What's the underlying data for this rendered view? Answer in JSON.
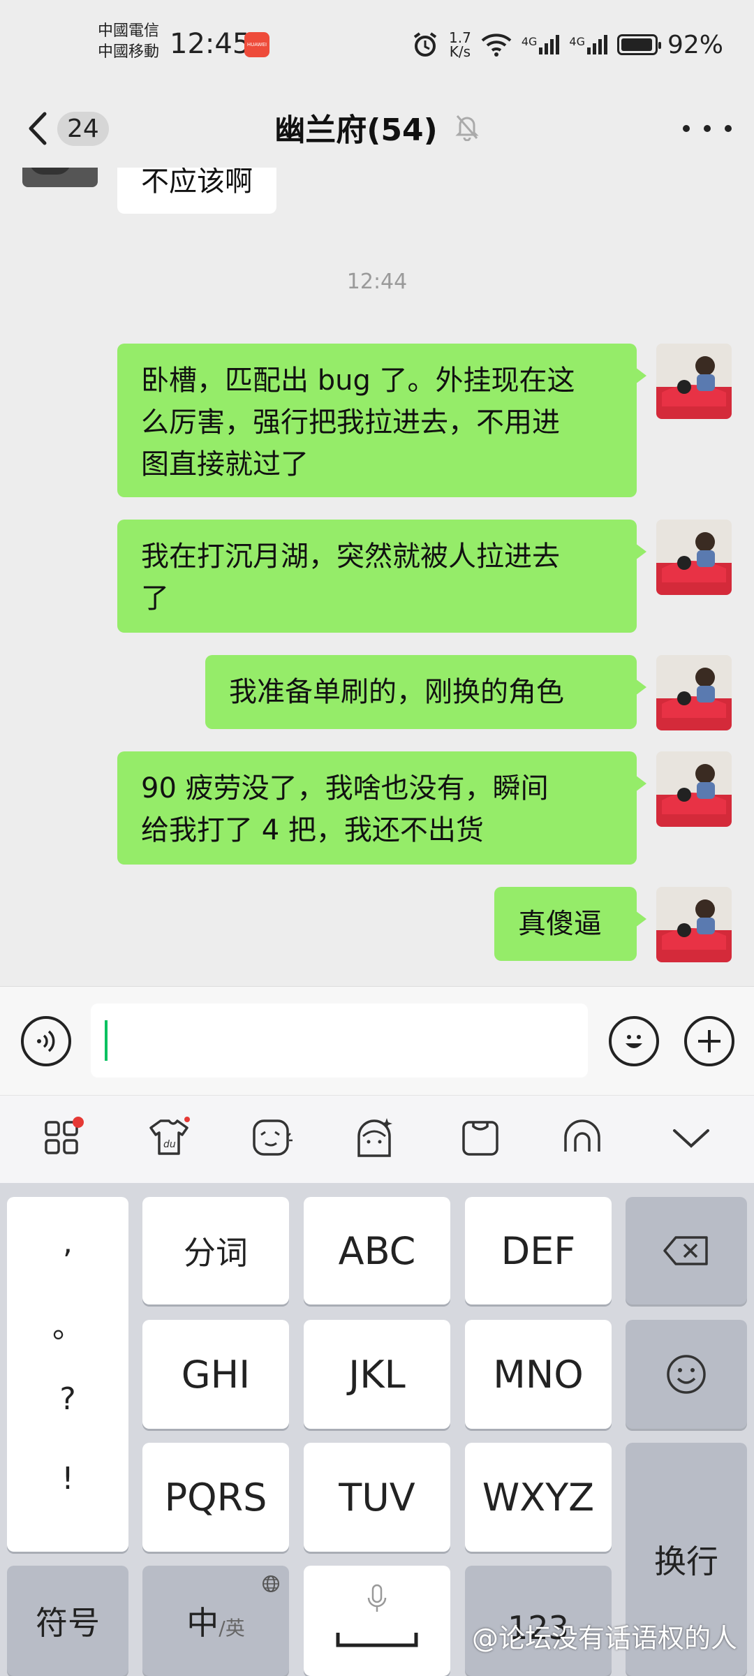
{
  "status_bar": {
    "carrier_1": "中國電信",
    "carrier_2": "中國移動",
    "time": "12:45",
    "net_speed_value": "1.7",
    "net_speed_unit": "K/s",
    "signal_1": "4G",
    "signal_2": "4G",
    "battery": "92%"
  },
  "nav": {
    "unread_count": "24",
    "title": "幽兰府(54)"
  },
  "chat": {
    "partial_incoming": "不应该啊",
    "timestamp": "12:44",
    "messages": [
      {
        "line1": "卧槽，匹配出 bug 了。外挂现在这",
        "line2": "么厉害，强行把我拉进去，不用进",
        "line3": "图直接就过了"
      },
      {
        "line1": "我在打沉月湖，突然就被人拉进去",
        "line2": "了"
      },
      {
        "line1": "我准备单刷的，刚换的角色"
      },
      {
        "line1": "90 疲劳没了，我啥也没有，瞬间",
        "line2": "给我打了 4 把，我还不出货"
      },
      {
        "line1": "真傻逼"
      }
    ]
  },
  "keyboard": {
    "punct": [
      ",",
      "。",
      "?",
      "!"
    ],
    "row1": [
      "分词",
      "ABC",
      "DEF"
    ],
    "row2": [
      "GHI",
      "JKL",
      "MNO"
    ],
    "row3": [
      "PQRS",
      "TUV",
      "WXYZ"
    ],
    "symbols": "符号",
    "lang_main": "中",
    "lang_alt": "/英",
    "numbers": "123",
    "enter": "换行"
  },
  "watermark": "@论坛没有话语权的人",
  "colors": {
    "outgoing_bubble": "#95ec69",
    "incoming_bubble": "#ffffff",
    "background": "#ededed",
    "notify_dot": "#e53935"
  }
}
